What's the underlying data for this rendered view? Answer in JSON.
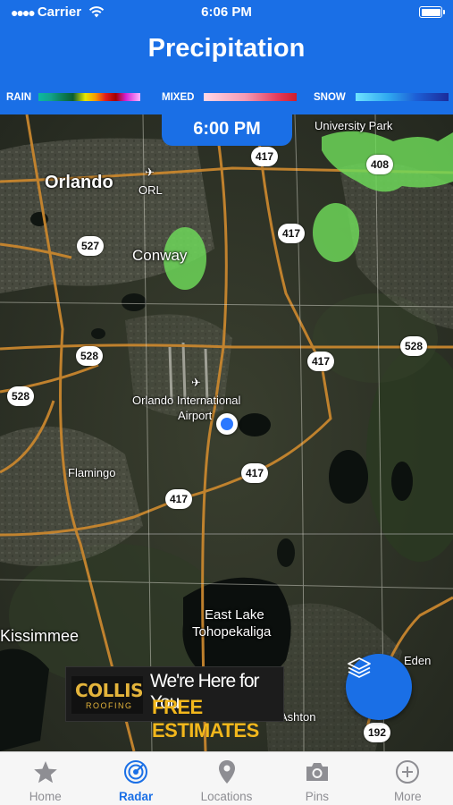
{
  "status_bar": {
    "carrier": "Carrier",
    "time": "6:06 PM"
  },
  "header": {
    "title": "Precipitation",
    "legend": {
      "rain": "RAIN",
      "mixed": "MIXED",
      "snow": "SNOW"
    }
  },
  "time_pill": "6:00 PM",
  "map": {
    "labels": {
      "orlando": "Orlando",
      "orl": "ORL",
      "conway": "Conway",
      "airport_line1": "Orlando International",
      "airport_line2": "Airport",
      "flamingo": "Flamingo",
      "east_lake_line1": "East Lake",
      "east_lake_line2": "Tohopekaliga",
      "kissimmee": "Kissimmee",
      "ashton": "Ashton",
      "eden": "Eden",
      "university_park": "University Park"
    },
    "shields": {
      "s417_a": "417",
      "s408": "408",
      "s417_b": "417",
      "s527": "527",
      "s528_a": "528",
      "s528_b": "528",
      "s528_c": "528",
      "s417_c": "417",
      "s417_d": "417",
      "s417_e": "417",
      "s192": "192"
    }
  },
  "ad": {
    "brand": "COLLIS",
    "brand_sub": "ROOFING",
    "line1": "We're Here for You",
    "line2": "FREE ESTIMATES"
  },
  "tabs": [
    {
      "label": "Home",
      "icon": "star-icon"
    },
    {
      "label": "Radar",
      "icon": "radar-icon"
    },
    {
      "label": "Locations",
      "icon": "map-pin-icon"
    },
    {
      "label": "Pins",
      "icon": "camera-icon"
    },
    {
      "label": "More",
      "icon": "plus-circle-icon"
    }
  ],
  "colors": {
    "accent": "#1a6fe6",
    "precip_green": "#6fdc5a",
    "tab_inactive": "#8e8e93"
  }
}
